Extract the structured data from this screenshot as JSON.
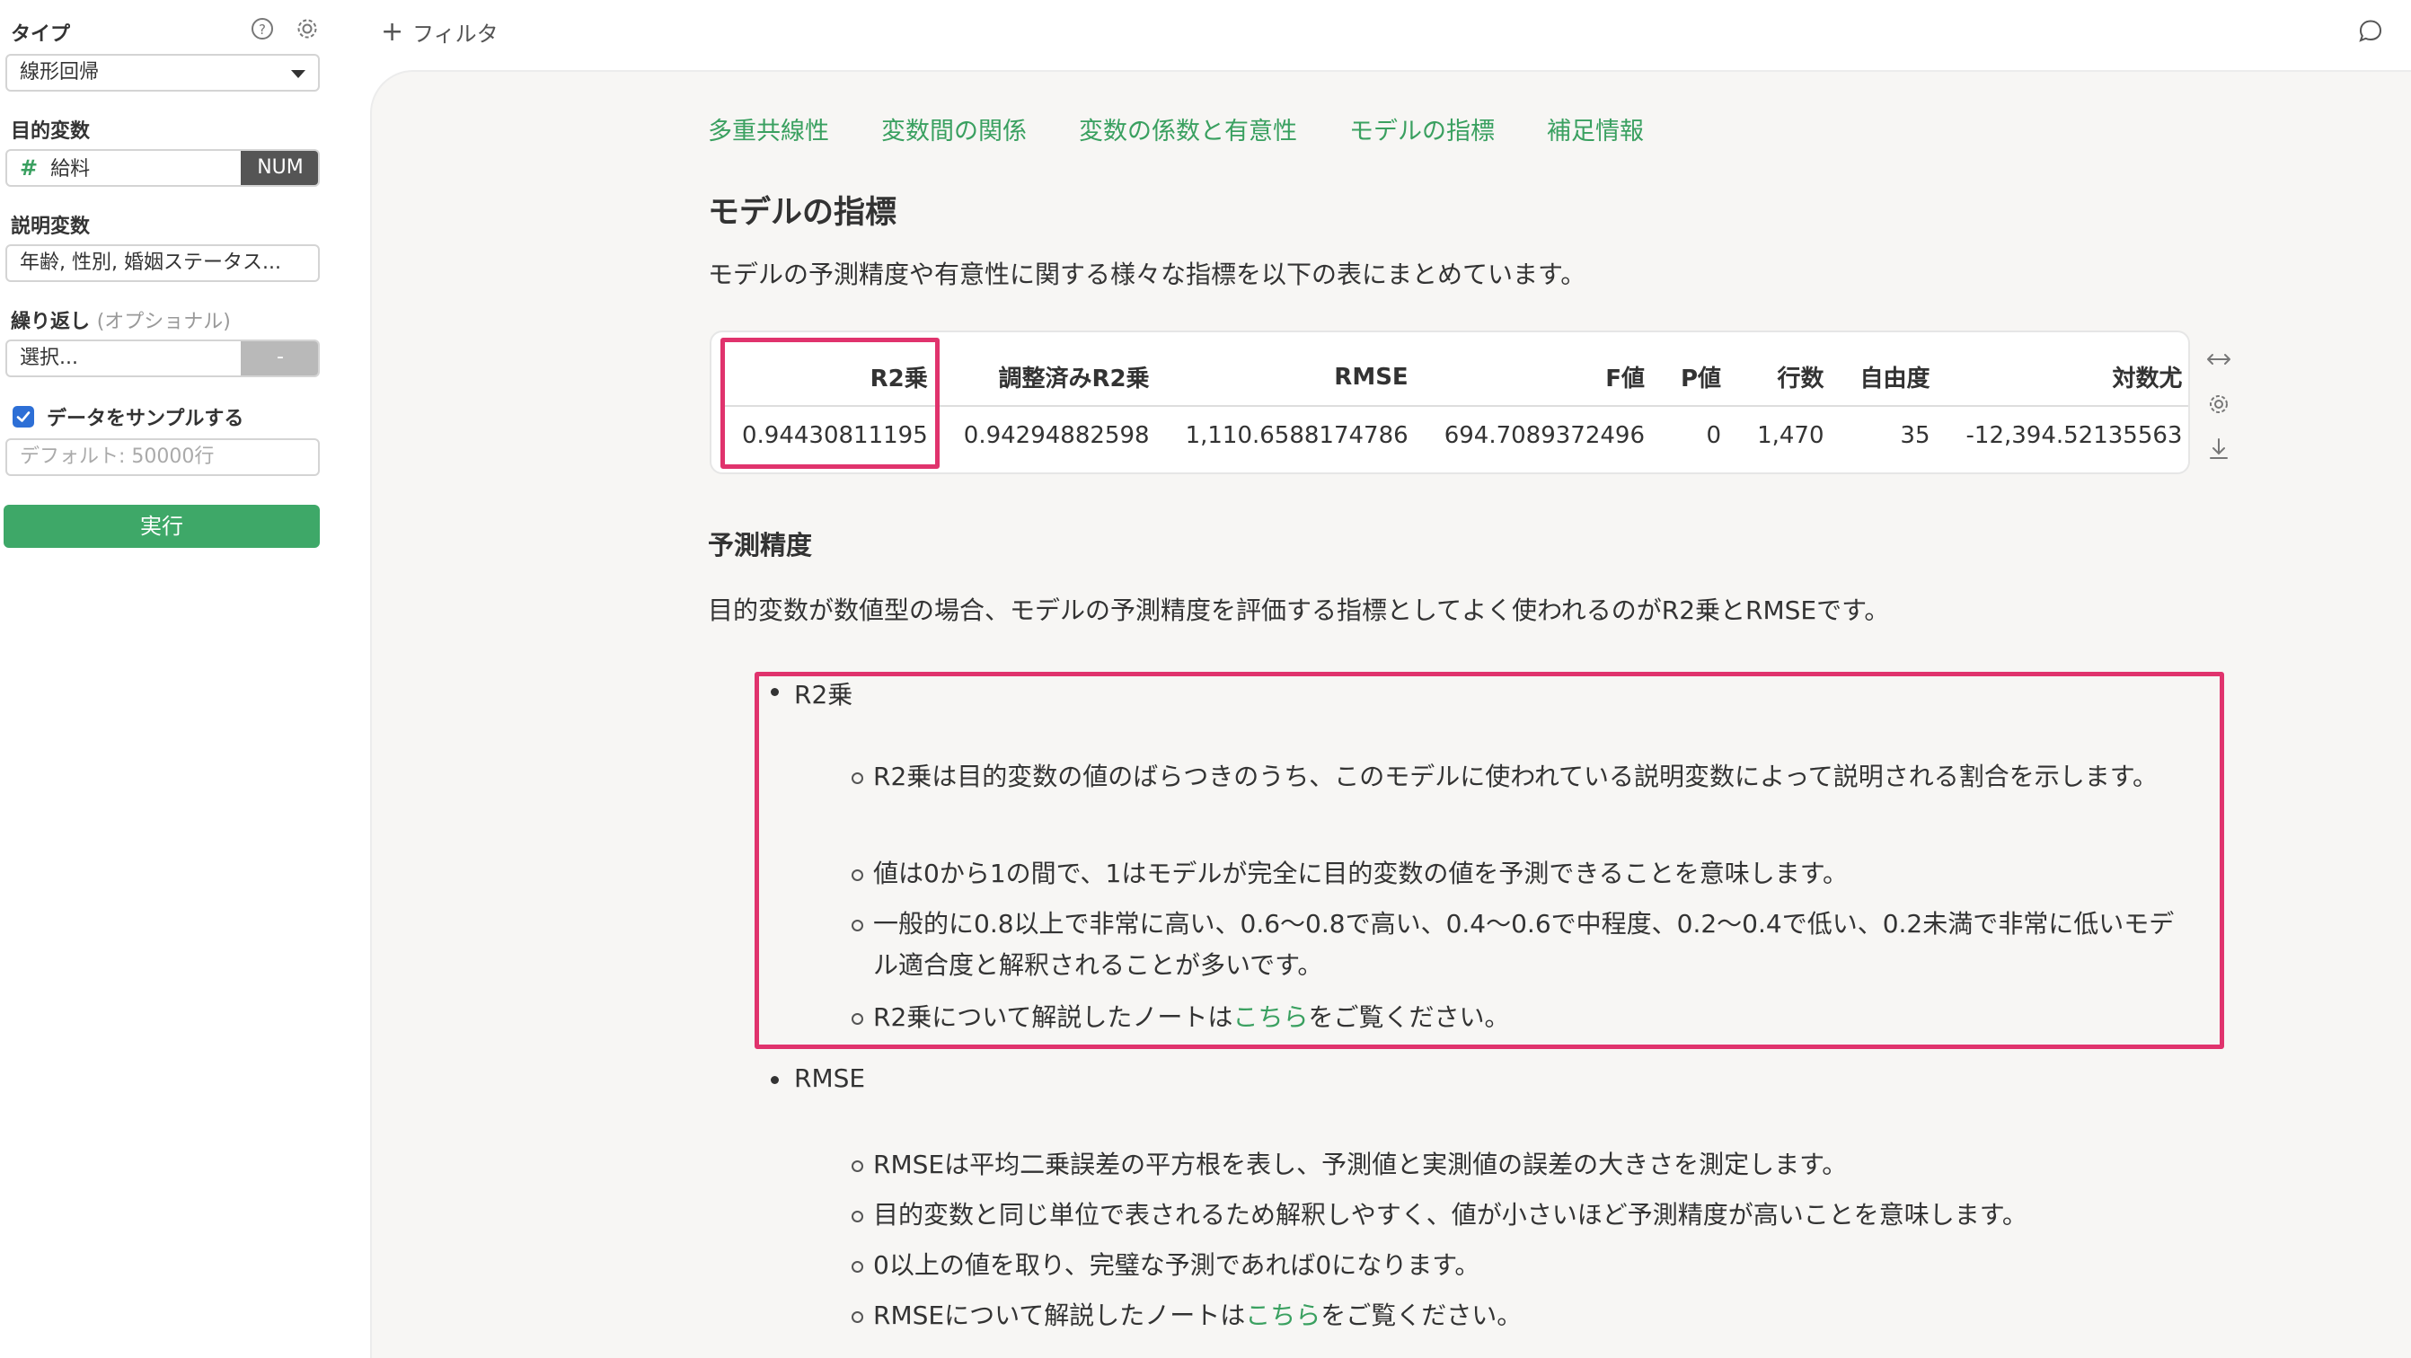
{
  "sidebar": {
    "type_label": "タイプ",
    "type_value": "線形回帰",
    "target_label": "目的変数",
    "target_hash": "#",
    "target_value": "給料",
    "target_badge": "NUM",
    "explanatory_label": "説明変数",
    "explanatory_value": "年齢, 性別, 婚姻ステータス...",
    "repeat_label": "繰り返し",
    "repeat_optional": "(オプショナル)",
    "repeat_placeholder": "選択...",
    "repeat_button": "-",
    "sample_label": "データをサンプルする",
    "sample_checked": true,
    "sample_placeholder": "デフォルト: 50000行",
    "run_label": "実行"
  },
  "topbar": {
    "filter_plus": "+",
    "filter_label": "フィルタ"
  },
  "main": {
    "tabs": [
      "多重共線性",
      "変数間の関係",
      "変数の係数と有意性",
      "モデルの指標",
      "補足情報"
    ],
    "title": "モデルの指標",
    "description": "モデルの予測精度や有意性に関する様々な指標を以下の表にまとめています。",
    "table": {
      "headers": [
        "R2乗",
        "調整済みR2乗",
        "RMSE",
        "F値",
        "P値",
        "行数",
        "自由度",
        "対数尤"
      ],
      "rows": [
        [
          "0.94430811195",
          "0.94294882598",
          "1,110.6588174786",
          "694.7089372496",
          "0",
          "1,470",
          "35",
          "-12,394.52135563"
        ]
      ]
    },
    "section_title": "予測精度",
    "section_desc": "目的変数が数値型の場合、モデルの予測精度を評価する指標としてよく使われるのがR2乗とRMSEです。",
    "r2": {
      "title": "R2乗",
      "items": [
        "R2乗は目的変数の値のばらつきのうち、このモデルに使われている説明変数によって説明される割合を示します。",
        "値は0から1の間で、1はモデルが完全に目的変数の値を予測できることを意味します。",
        "一般的に0.8以上で非常に高い、0.6〜0.8で高い、0.4〜0.6で中程度、0.2〜0.4で低い、0.2未満で非常に低いモデル適合度と解釈されることが多いです。"
      ],
      "link_prefix": "R2乗について解説したノートは",
      "link_text": "こちら",
      "link_suffix": "をご覧ください。"
    },
    "rmse": {
      "title": "RMSE",
      "items": [
        "RMSEは平均二乗誤差の平方根を表し、予測値と実測値の誤差の大きさを測定します。",
        "目的変数と同じ単位で表されるため解釈しやすく、値が小さいほど予測精度が高いことを意味します。",
        "0以上の値を取り、完璧な予測であれば0になります。"
      ],
      "link_prefix": "RMSEについて解説したノートは",
      "link_text": "こちら",
      "link_suffix": "をご覧ください。"
    }
  },
  "colors": {
    "accent_green": "#3aa060",
    "highlight": "#e0336d",
    "run_button": "#3ea868"
  },
  "icons": [
    "help-icon",
    "settings-icon",
    "caret-down-icon",
    "check-icon",
    "comment-icon",
    "expand-icon",
    "table-settings-icon",
    "download-icon"
  ]
}
